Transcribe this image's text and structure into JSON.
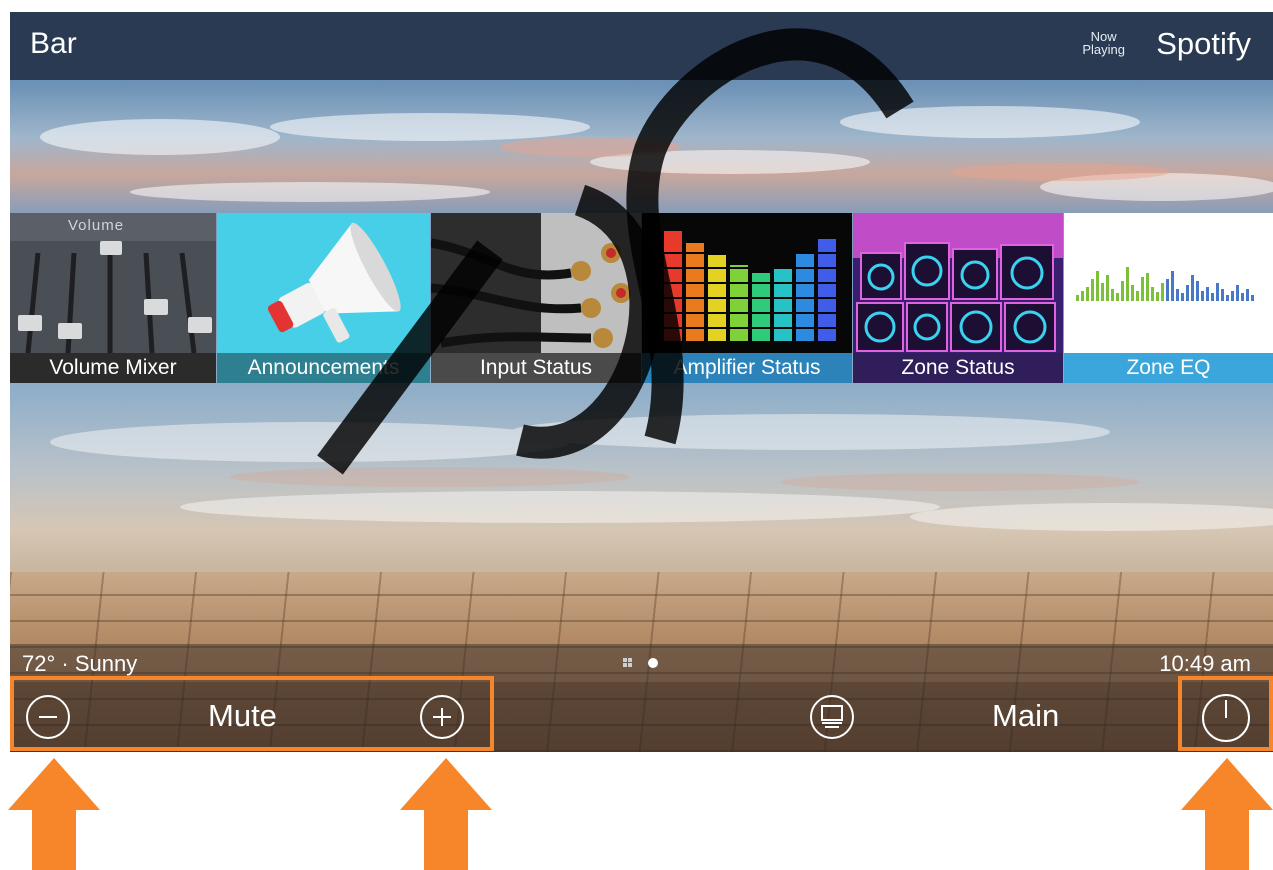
{
  "header": {
    "zone_name": "Bar",
    "now_playing_line1": "Now",
    "now_playing_line2": "Playing",
    "source": "Spotify"
  },
  "tiles": [
    {
      "label": "Volume Mixer",
      "art_text": "Volume",
      "label_bg": "#2b2b2b"
    },
    {
      "label": "Announcements",
      "label_bg": "#2e7f90"
    },
    {
      "label": "Input Status",
      "label_bg": "#4a4a4a"
    },
    {
      "label": "Amplifier Status",
      "label_bg": "#2b83b9"
    },
    {
      "label": "Zone Status",
      "label_bg": "#2f1e5a"
    },
    {
      "label": "Zone EQ",
      "label_bg": "#3aa6dc"
    }
  ],
  "status": {
    "weather": "72° · Sunny",
    "time": "10:49 am"
  },
  "controls": {
    "volume_down_icon": "minus-circle-icon",
    "mute_label": "Mute",
    "volume_up_icon": "plus-circle-icon",
    "source_icon": "source-select-icon",
    "main_label": "Main",
    "power_icon": "power-icon"
  },
  "colors": {
    "accent_highlight": "#f7862b",
    "header_bg": "#2a3a52"
  }
}
